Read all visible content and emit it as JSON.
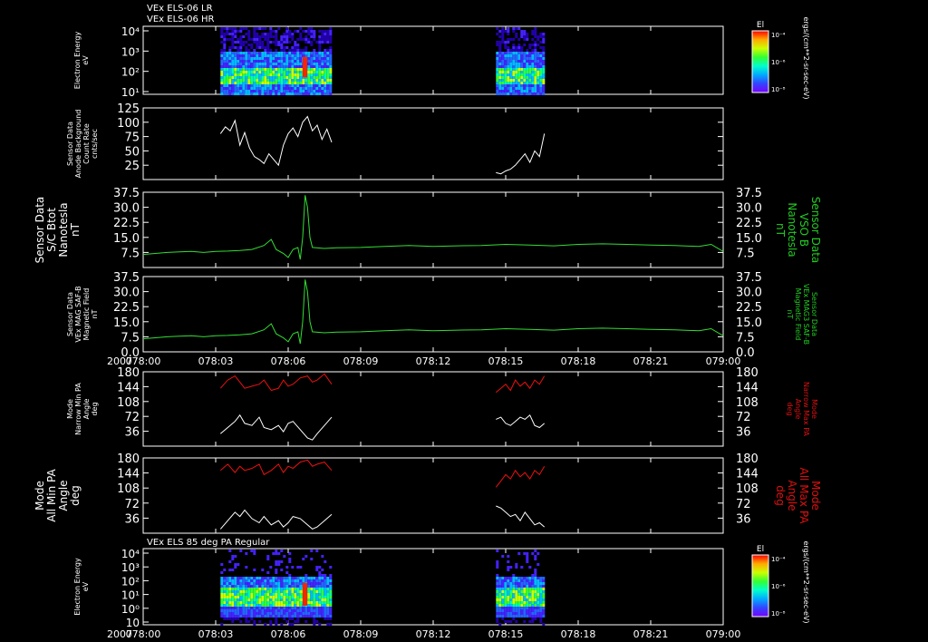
{
  "colors": {
    "background": "#000000",
    "axis": "#ffffff",
    "green_trace": "#33dd33",
    "red_trace": "#ee1111",
    "white_trace": "#ffffff",
    "right_label_green": "#22cc22",
    "right_label_red": "#dd1111"
  },
  "time_axis": {
    "year_label": "2007",
    "ticks": [
      "078:00",
      "078:03",
      "078:06",
      "078:09",
      "078:12",
      "078:15",
      "078:18",
      "078:21",
      "079:00"
    ],
    "range_hours": [
      0,
      24
    ]
  },
  "colorbar_top": {
    "title": "El",
    "ticks": [
      "10⁻⁴",
      "10⁻⁶",
      "10⁻⁸"
    ],
    "side_label": "ergs/(cm**2-sr-sec-eV)"
  },
  "colorbar_bottom": {
    "title": "El",
    "ticks": [
      "10⁻⁴",
      "10⁻⁶",
      "10⁻⁸"
    ],
    "side_label": "ergs/(cm**2-sr-sec-eV)"
  },
  "chart_data": [
    {
      "type": "heatmap",
      "id": "panel1",
      "annotations": [
        "VEx ELS-06 LR",
        "VEx ELS-06 HR"
      ],
      "ylabel_lines": [
        "Electron Energy",
        "eV"
      ],
      "y_ticks": [
        "10⁴",
        "10³",
        "10²",
        "10¹"
      ],
      "data_blocks": [
        {
          "t_start": 3.2,
          "t_end": 7.8
        },
        {
          "t_start": 14.6,
          "t_end": 16.6
        }
      ]
    },
    {
      "type": "line",
      "id": "panel2",
      "ylabel_lines": [
        "Sensor Data",
        "Anode Background",
        "Count Rate",
        "cnts/sec"
      ],
      "ylim": [
        0,
        125
      ],
      "y_ticks": [
        "125",
        "100",
        "75",
        "50",
        "25"
      ],
      "y_tick_values": [
        125,
        100,
        75,
        50,
        25
      ],
      "series": [
        {
          "x": [
            3.2,
            3.4,
            3.6,
            3.8,
            4.0,
            4.2,
            4.4,
            4.6,
            4.8,
            5.0,
            5.2,
            5.4,
            5.6,
            5.8,
            6.0,
            6.2,
            6.4,
            6.6,
            6.8,
            7.0,
            7.2,
            7.4,
            7.6,
            7.8
          ],
          "y": [
            80,
            92,
            85,
            103,
            60,
            82,
            55,
            40,
            35,
            28,
            45,
            35,
            25,
            60,
            80,
            90,
            75,
            100,
            110,
            85,
            95,
            70,
            88,
            65
          ]
        },
        {
          "x": [
            14.6,
            14.8,
            15.0,
            15.2,
            15.4,
            15.6,
            15.8,
            16.0,
            16.2,
            16.4,
            16.6
          ],
          "y": [
            12,
            10,
            15,
            18,
            25,
            35,
            45,
            30,
            50,
            40,
            80
          ]
        }
      ]
    },
    {
      "type": "line",
      "id": "panel3",
      "ylabel_lines": [
        "Sensor Data",
        "S/C Btot",
        "Nanotesla",
        "nT"
      ],
      "right_label_lines": [
        "Sensor Data",
        "VSO B",
        "Nanotesla",
        "nT"
      ],
      "ylim": [
        0,
        37.5
      ],
      "y_ticks": [
        "37.5",
        "30.0",
        "22.5",
        "15.0",
        "7.5"
      ],
      "y_tick_values": [
        37.5,
        30.0,
        22.5,
        15.0,
        7.5
      ],
      "series": [
        {
          "x": [
            0,
            0.5,
            1,
            1.5,
            2,
            2.5,
            3,
            3.5,
            4,
            4.5,
            5,
            5.3,
            5.5,
            5.8,
            6.0,
            6.2,
            6.4,
            6.5,
            6.6,
            6.7,
            6.8,
            6.9,
            7.0,
            7.5,
            8,
            9,
            10,
            11,
            12,
            13,
            14,
            15,
            16,
            17,
            18,
            19,
            20,
            21,
            22,
            23,
            23.5,
            24
          ],
          "y": [
            6.5,
            7,
            7.5,
            7.8,
            8,
            7.5,
            8,
            8.2,
            8.5,
            9,
            11,
            14,
            9,
            7,
            5,
            9,
            10,
            4,
            15,
            36,
            30,
            15,
            10,
            9.5,
            9.8,
            10,
            10.5,
            11,
            10.5,
            10.8,
            11,
            11.5,
            11.2,
            10.8,
            11.5,
            11.8,
            11.5,
            11.2,
            11,
            10.5,
            11.5,
            8
          ]
        }
      ]
    },
    {
      "type": "line",
      "id": "panel4",
      "ylabel_lines": [
        "Sensor Data",
        "VEx MAG SAF-B",
        "Magnetic Field",
        "nT"
      ],
      "right_label_lines": [
        "Sensor Data",
        "VEx MAG3 SAF-B",
        "Magnetic Field",
        "nT"
      ],
      "ylim": [
        0,
        37.5
      ],
      "y_ticks": [
        "37.5",
        "30.0",
        "22.5",
        "15.0",
        "7.5",
        "0.0"
      ],
      "y_tick_values": [
        37.5,
        30.0,
        22.5,
        15.0,
        7.5,
        0.0
      ],
      "series": [
        {
          "x": [
            0,
            0.5,
            1,
            1.5,
            2,
            2.5,
            3,
            3.5,
            4,
            4.5,
            5,
            5.3,
            5.5,
            5.8,
            6.0,
            6.2,
            6.4,
            6.5,
            6.6,
            6.7,
            6.8,
            6.9,
            7.0,
            7.5,
            8,
            9,
            10,
            11,
            12,
            13,
            14,
            15,
            16,
            17,
            18,
            19,
            20,
            21,
            22,
            23,
            23.5,
            24
          ],
          "y": [
            6.5,
            7,
            7.5,
            7.8,
            8,
            7.5,
            8,
            8.2,
            8.5,
            9,
            11,
            14,
            9,
            7,
            5,
            9,
            10,
            4,
            15,
            36,
            30,
            15,
            10,
            9.5,
            9.8,
            10,
            10.5,
            11,
            10.5,
            10.8,
            11,
            11.5,
            11.2,
            10.8,
            11.5,
            11.8,
            11.5,
            11.2,
            11,
            10.5,
            11.5,
            8
          ]
        }
      ]
    },
    {
      "type": "line",
      "id": "panel5",
      "ylabel_lines": [
        "Mode",
        "Narrow Min PA",
        "Angle",
        "deg"
      ],
      "right_label_lines": [
        "Mode",
        "Narrow Max PA",
        "Angle",
        "deg"
      ],
      "ylim": [
        0,
        180
      ],
      "y_ticks": [
        "180",
        "144",
        "108",
        "72",
        "36"
      ],
      "y_tick_values": [
        180,
        144,
        108,
        72,
        36
      ],
      "series": [
        {
          "x": [
            3.2,
            3.5,
            3.8,
            4.0,
            4.2,
            4.5,
            4.8,
            5.0,
            5.3,
            5.6,
            5.8,
            6.0,
            6.2,
            6.5,
            6.8,
            7.0,
            7.2,
            7.5,
            7.8
          ],
          "y": [
            140,
            160,
            170,
            155,
            140,
            145,
            150,
            160,
            135,
            140,
            160,
            145,
            150,
            165,
            170,
            155,
            160,
            175,
            150
          ]
        },
        {
          "x": [
            3.2,
            3.5,
            3.8,
            4.0,
            4.2,
            4.5,
            4.8,
            5.0,
            5.3,
            5.6,
            5.8,
            6.0,
            6.2,
            6.5,
            6.8,
            7.0,
            7.2,
            7.5,
            7.8
          ],
          "y": [
            30,
            45,
            60,
            75,
            55,
            50,
            70,
            45,
            40,
            50,
            35,
            55,
            60,
            40,
            20,
            15,
            30,
            50,
            70
          ]
        },
        {
          "x": [
            14.6,
            14.8,
            15.0,
            15.2,
            15.4,
            15.6,
            15.8,
            16.0,
            16.2,
            16.4,
            16.6
          ],
          "y": [
            130,
            140,
            150,
            135,
            160,
            145,
            155,
            140,
            160,
            150,
            170
          ]
        },
        {
          "x": [
            14.6,
            14.8,
            15.0,
            15.2,
            15.4,
            15.6,
            15.8,
            16.0,
            16.2,
            16.4,
            16.6
          ],
          "y": [
            65,
            70,
            55,
            50,
            60,
            70,
            65,
            75,
            50,
            45,
            55
          ]
        }
      ]
    },
    {
      "type": "line",
      "id": "panel6",
      "ylabel_lines": [
        "Mode",
        "All Min PA",
        "Angle",
        "deg"
      ],
      "right_label_lines": [
        "Mode",
        "All Max PA",
        "Angle",
        "deg"
      ],
      "ylim": [
        0,
        180
      ],
      "y_ticks": [
        "180",
        "144",
        "108",
        "72",
        "36"
      ],
      "y_tick_values": [
        180,
        144,
        108,
        72,
        36
      ],
      "series": [
        {
          "x": [
            3.2,
            3.5,
            3.8,
            4.0,
            4.2,
            4.5,
            4.8,
            5.0,
            5.3,
            5.6,
            5.8,
            6.0,
            6.2,
            6.5,
            6.8,
            7.0,
            7.2,
            7.5,
            7.8
          ],
          "y": [
            150,
            165,
            145,
            160,
            150,
            155,
            165,
            140,
            150,
            165,
            145,
            160,
            155,
            170,
            175,
            160,
            165,
            170,
            150
          ]
        },
        {
          "x": [
            3.2,
            3.5,
            3.8,
            4.0,
            4.2,
            4.5,
            4.8,
            5.0,
            5.3,
            5.6,
            5.8,
            6.0,
            6.2,
            6.5,
            6.8,
            7.0,
            7.2,
            7.5,
            7.8
          ],
          "y": [
            10,
            30,
            50,
            40,
            55,
            35,
            25,
            40,
            20,
            30,
            15,
            25,
            40,
            35,
            20,
            10,
            15,
            30,
            45
          ]
        },
        {
          "x": [
            14.6,
            14.8,
            15.0,
            15.2,
            15.4,
            15.6,
            15.8,
            16.0,
            16.2,
            16.4,
            16.6
          ],
          "y": [
            110,
            125,
            140,
            130,
            150,
            135,
            145,
            130,
            150,
            140,
            160
          ]
        },
        {
          "x": [
            14.6,
            14.8,
            15.0,
            15.2,
            15.4,
            15.6,
            15.8,
            16.0,
            16.2,
            16.4,
            16.6
          ],
          "y": [
            65,
            60,
            50,
            40,
            45,
            30,
            50,
            35,
            20,
            25,
            15
          ]
        }
      ]
    },
    {
      "type": "heatmap",
      "id": "panel7",
      "annotations": [
        "VEx ELS 85 deg PA Regular"
      ],
      "ylabel_lines": [
        "Electron Energy",
        "eV"
      ],
      "y_ticks": [
        "10⁴",
        "10³",
        "10²",
        "10¹",
        "10⁰",
        "10"
      ],
      "data_blocks": [
        {
          "t_start": 3.2,
          "t_end": 7.8
        },
        {
          "t_start": 14.6,
          "t_end": 16.6
        }
      ]
    }
  ]
}
